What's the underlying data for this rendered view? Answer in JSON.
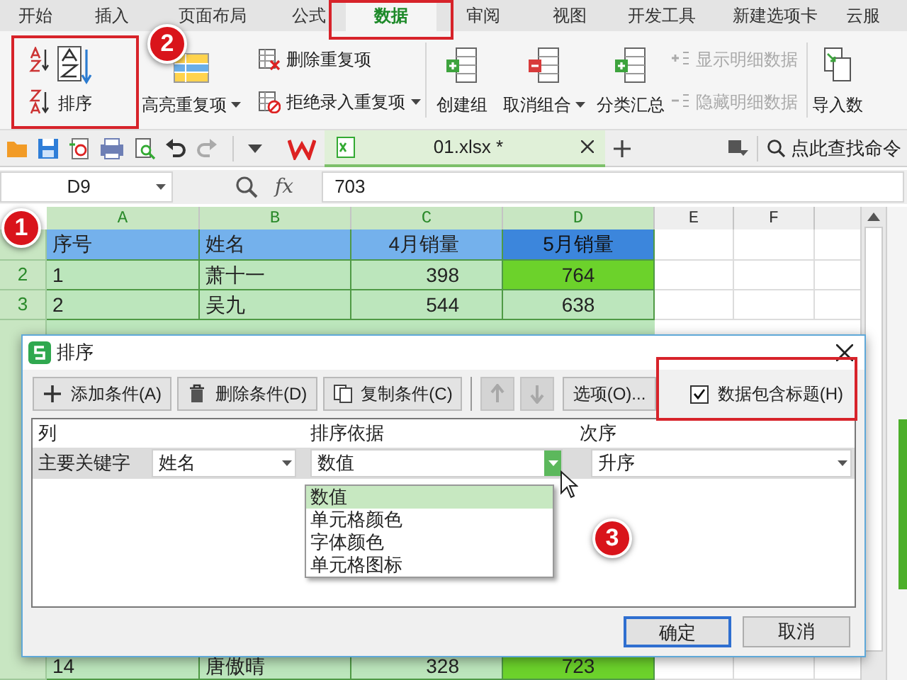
{
  "tabs": [
    {
      "label": "开始",
      "selected": false
    },
    {
      "label": "插入",
      "selected": false
    },
    {
      "label": "页面布局",
      "selected": false
    },
    {
      "label": "公式",
      "selected": false
    },
    {
      "label": "数据",
      "selected": true
    },
    {
      "label": "审阅",
      "selected": false
    },
    {
      "label": "视图",
      "selected": false
    },
    {
      "label": "开发工具",
      "selected": false
    },
    {
      "label": "新建选项卡",
      "selected": false
    },
    {
      "label": "云服",
      "selected": false
    }
  ],
  "ribbon": {
    "sort_label": "排序",
    "highlight_duplicates": "高亮重复项",
    "remove_duplicates": "删除重复项",
    "reject_duplicates": "拒绝录入重复项",
    "create_group": "创建组",
    "ungroup": "取消组合",
    "subtotal": "分类汇总",
    "show_detail": {
      "label": "显示明细数据",
      "disabled": true
    },
    "hide_detail": {
      "label": "隐藏明细数据",
      "disabled": true
    },
    "import_data": "导入数"
  },
  "quick_bar": {
    "file_tab": "01.xlsx *",
    "search": "点此查找命令"
  },
  "formula_bar": {
    "cell_ref": "D9",
    "fx": "fx",
    "value": "703"
  },
  "sheet": {
    "columns": [
      {
        "label": "A",
        "selected": true
      },
      {
        "label": "B",
        "selected": true
      },
      {
        "label": "C",
        "selected": true
      },
      {
        "label": "D",
        "selected": true
      },
      {
        "label": "E",
        "selected": false
      },
      {
        "label": "F",
        "selected": false
      }
    ],
    "rows": [
      {
        "cells": [
          {
            "text": "序号",
            "color": "#74b1ec"
          },
          {
            "text": "姓名",
            "color": "#74b1ec"
          },
          {
            "text": "4月销量",
            "color": "#74b1ec"
          },
          {
            "text": "5月销量",
            "color": "#3c86dc"
          }
        ]
      },
      {
        "header": "2",
        "cells": [
          {
            "text": "1"
          },
          {
            "text": "萧十一"
          },
          {
            "text": "398"
          },
          {
            "text": "764",
            "color": "#6cd22b"
          }
        ]
      },
      {
        "header": "3",
        "cells": [
          {
            "text": "2"
          },
          {
            "text": "吴九"
          },
          {
            "text": "544"
          },
          {
            "text": "638"
          }
        ]
      }
    ],
    "last_row": {
      "cells": [
        {
          "text": "14"
        },
        {
          "text": "唐傲晴"
        },
        {
          "text": "328"
        },
        {
          "text": "723",
          "color": "#6cd22b"
        }
      ]
    }
  },
  "dialog": {
    "title": "排序",
    "toolbar": [
      {
        "kind": "add",
        "label": "添加条件(A)"
      },
      {
        "kind": "delete",
        "label": "删除条件(D)"
      },
      {
        "kind": "copy",
        "label": "复制条件(C)"
      }
    ],
    "move_buttons": [
      {
        "kind": "up",
        "disabled": true
      },
      {
        "kind": "down",
        "disabled": true
      }
    ],
    "options_button": "选项(O)...",
    "header_checkbox": {
      "label": "数据包含标题(H)",
      "checked": true
    },
    "headers": [
      "列",
      "排序依据",
      "次序"
    ],
    "condition": {
      "label": "主要关键字",
      "column": "姓名",
      "sort_on": "数值",
      "order": "升序"
    },
    "dropdown": {
      "expanded": true,
      "options": [
        {
          "label": "数值",
          "selected": true
        },
        {
          "label": "单元格颜色",
          "selected": false
        },
        {
          "label": "字体颜色",
          "selected": false
        },
        {
          "label": "单元格图标",
          "selected": false
        }
      ]
    },
    "buttons": [
      {
        "label": "确定",
        "focused": true
      },
      {
        "label": "取消",
        "focused": false
      }
    ]
  },
  "annotations": [
    {
      "label": "1"
    },
    {
      "label": "2"
    },
    {
      "label": "3"
    }
  ]
}
